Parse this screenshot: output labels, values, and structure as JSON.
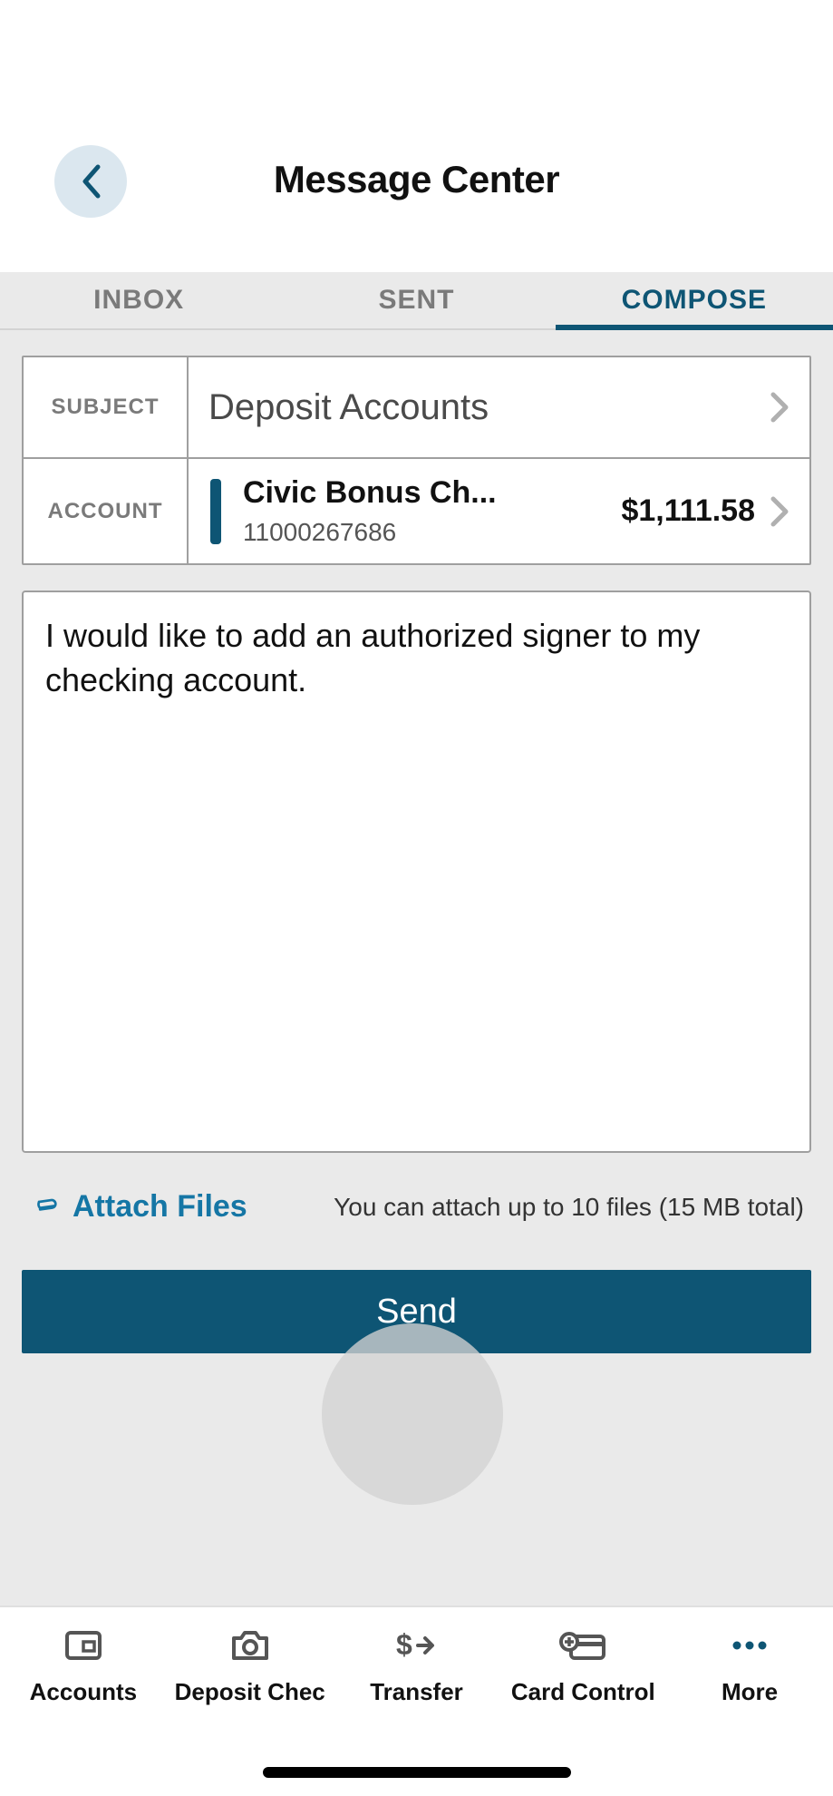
{
  "header": {
    "title": "Message Center"
  },
  "tabs": {
    "inbox": "INBOX",
    "sent": "SENT",
    "compose": "COMPOSE"
  },
  "form": {
    "subject_label": "SUBJECT",
    "subject_value": "Deposit Accounts",
    "account_label": "ACCOUNT",
    "account_name": "Civic Bonus Ch...",
    "account_number": "11000267686",
    "account_balance": "$1,111.58"
  },
  "message_body": "I would like to add an authorized signer to my checking account.",
  "attach": {
    "label": "Attach Files",
    "hint": "You can attach up to 10 files (15 MB total)"
  },
  "send_label": "Send",
  "nav": {
    "accounts": "Accounts",
    "deposit": "Deposit Chec",
    "transfer": "Transfer",
    "card": "Card Control",
    "more": "More"
  }
}
